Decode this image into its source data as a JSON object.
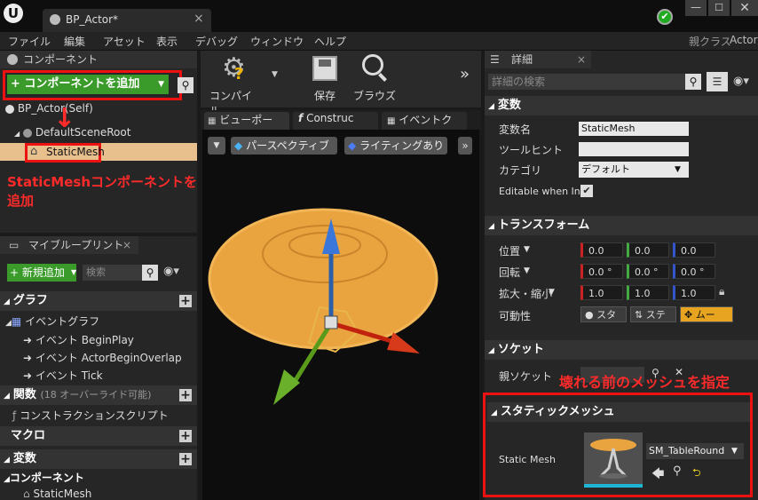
{
  "titlebar": {
    "logo": "unreal-logo",
    "tab_title": "BP_Actor*"
  },
  "menu": [
    "ファイル",
    "編集",
    "アセット",
    "表示",
    "デバッグ",
    "ウィンドウ",
    "ヘルプ"
  ],
  "parent_class": {
    "label": "親クラス",
    "value": "Actor"
  },
  "components": {
    "title": "コンポーネント",
    "add_button": "+ コンポーネントを追加",
    "tree": [
      "BP_Actor(Self)",
      "DefaultSceneRoot",
      "StaticMesh"
    ]
  },
  "annotation_add": "StaticMeshコンポーネントを追加",
  "my_blueprint": {
    "title": "マイブループリント",
    "add_new": "+ 新規追加",
    "search_placeholder": "検索",
    "graph_section": "グラフ",
    "event_graph": "イベントグラフ",
    "events": [
      "イベント BeginPlay",
      "イベント ActorBeginOverlap",
      "イベント Tick"
    ],
    "functions_section": "関数",
    "functions_note": "(18 オーバーライド可能)",
    "construction_script": "コンストラクションスクリプト",
    "macros_section": "マクロ",
    "variables_section": "変数",
    "components_section": "コンポーネント",
    "component_item": "StaticMesh"
  },
  "toolbar": {
    "compile": "コンパイル",
    "save": "保存",
    "browse": "ブラウズ"
  },
  "viewport_tabs": [
    "ビューポー",
    "Construc",
    "イベントク"
  ],
  "viewport": {
    "perspective": "パースペクティブ",
    "lighting": "ライティングあり"
  },
  "details": {
    "title": "詳細",
    "search_placeholder": "詳細の検索",
    "variable_section": "変数",
    "var_name_label": "変数名",
    "var_name_value": "StaticMesh",
    "tooltip_label": "ツールヒント",
    "category_label": "カテゴリ",
    "category_value": "デフォルト",
    "editable_label": "Editable when Inh",
    "transform_section": "トランスフォーム",
    "location_label": "位置",
    "rotation_label": "回転",
    "scale_label": "拡大・縮小",
    "mobility_label": "可動性",
    "location": [
      "0.0",
      "0.0",
      "0.0"
    ],
    "rotation": [
      "0.0 °",
      "0.0 °",
      "0.0 °"
    ],
    "scale": [
      "1.0",
      "1.0",
      "1.0"
    ],
    "mobility": [
      "スタ",
      "ステ",
      "ムー"
    ],
    "socket_section": "ソケット",
    "parent_socket_label": "親ソケット",
    "annotation_socket": "壊れる前のメッシュを指定",
    "static_mesh_section": "スタティックメッシュ",
    "static_mesh_label": "Static Mesh",
    "static_mesh_value": "SM_TableRound"
  }
}
